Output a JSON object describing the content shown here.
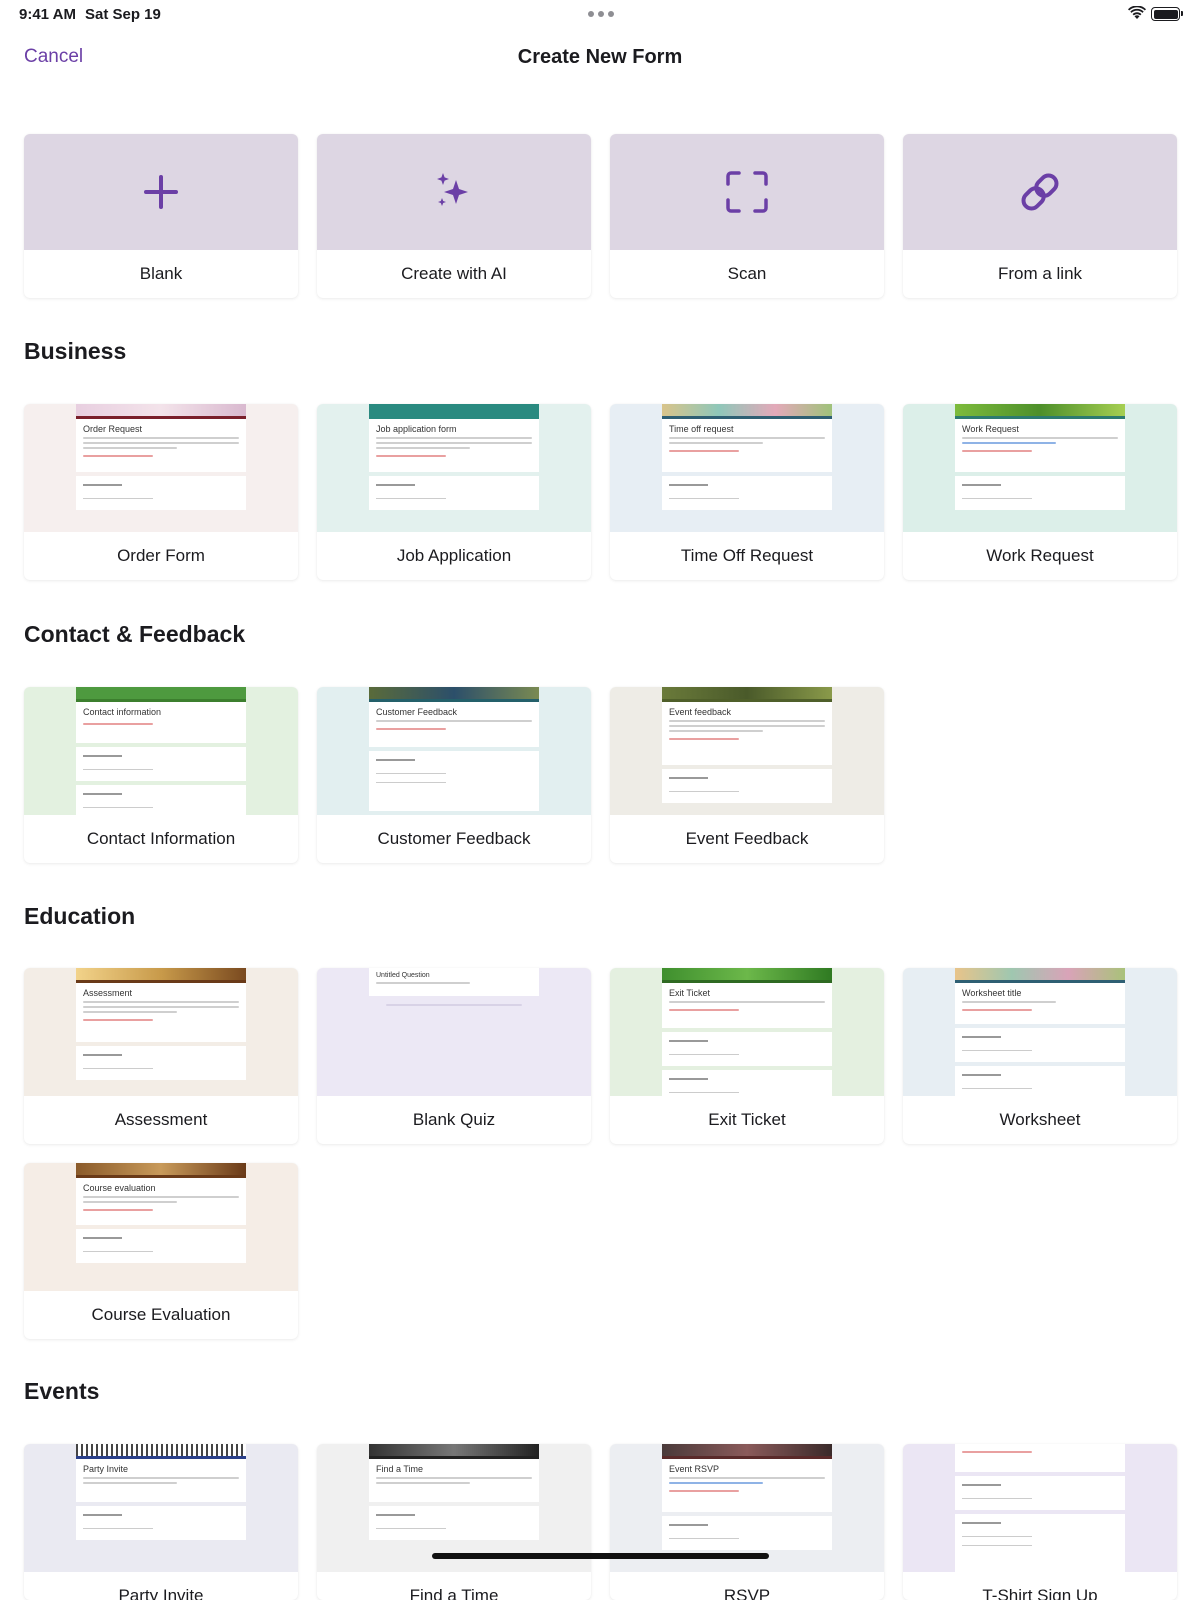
{
  "status": {
    "time": "9:41 AM",
    "date": "Sat Sep 19"
  },
  "nav": {
    "cancel": "Cancel",
    "title": "Create New Form"
  },
  "quick_actions": [
    {
      "label": "Blank",
      "icon": "plus-icon"
    },
    {
      "label": "Create with AI",
      "icon": "sparkle-icon"
    },
    {
      "label": "Scan",
      "icon": "scan-icon"
    },
    {
      "label": "From a link",
      "icon": "link-icon"
    }
  ],
  "colors": {
    "accent": "#6b3fa6",
    "tile": "#ddd6e3"
  },
  "sections": [
    {
      "title": "Business",
      "templates": [
        {
          "label": "Order Form",
          "preview_title": "Order Request"
        },
        {
          "label": "Job Application",
          "preview_title": "Job application form"
        },
        {
          "label": "Time Off Request",
          "preview_title": "Time off request"
        },
        {
          "label": "Work Request",
          "preview_title": "Work Request"
        }
      ]
    },
    {
      "title": "Contact & Feedback",
      "templates": [
        {
          "label": "Contact Information",
          "preview_title": "Contact information"
        },
        {
          "label": "Customer Feedback",
          "preview_title": "Customer Feedback"
        },
        {
          "label": "Event Feedback",
          "preview_title": "Event feedback"
        }
      ]
    },
    {
      "title": "Education",
      "templates": [
        {
          "label": "Assessment",
          "preview_title": "Assessment"
        },
        {
          "label": "Blank Quiz",
          "preview_title": "Untitled Question"
        },
        {
          "label": "Exit Ticket",
          "preview_title": "Exit Ticket"
        },
        {
          "label": "Worksheet",
          "preview_title": "Worksheet title"
        },
        {
          "label": "Course Evaluation",
          "preview_title": "Course evaluation"
        }
      ]
    },
    {
      "title": "Events",
      "templates": [
        {
          "label": "Party Invite",
          "preview_title": "Party Invite"
        },
        {
          "label": "Find a Time",
          "preview_title": "Find a Time"
        },
        {
          "label": "RSVP",
          "preview_title": "Event RSVP"
        },
        {
          "label": "T-Shirt Sign Up",
          "preview_title": ""
        }
      ]
    }
  ]
}
